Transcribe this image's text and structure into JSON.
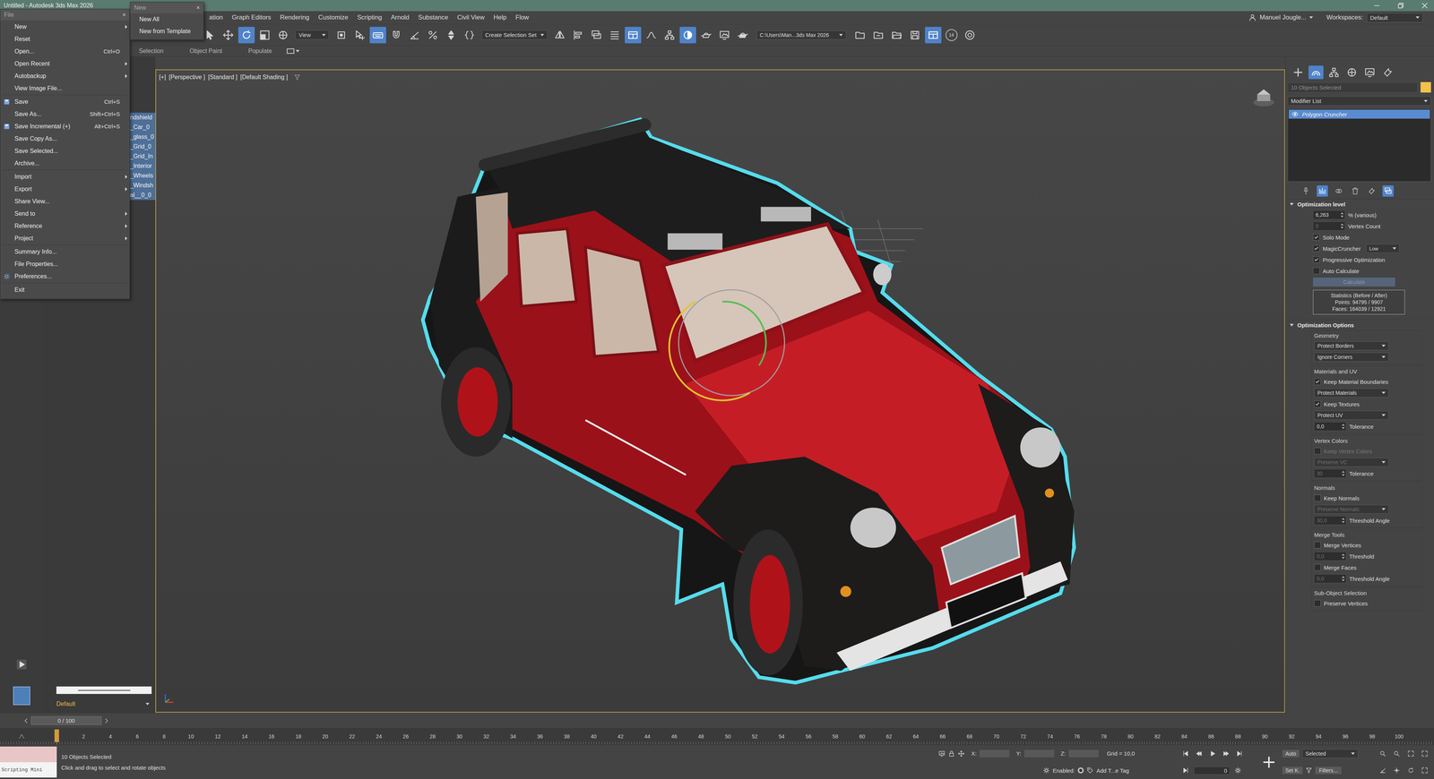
{
  "window": {
    "title": "Untitled - Autodesk 3ds Max 2026"
  },
  "menu_bar": {
    "items": [
      "ation",
      "Graph Editors",
      "Rendering",
      "Customize",
      "Scripting",
      "Arnold",
      "Substance",
      "Civil View",
      "Help",
      "Flow"
    ],
    "user": "Manuel Jougle...",
    "workspaces_label": "Workspaces:",
    "workspace": "Default"
  },
  "toolbar": {
    "items": [
      {
        "kind": "select",
        "selected": false
      },
      {
        "kind": "move",
        "selected": false
      },
      {
        "kind": "rotate",
        "selected": true
      },
      {
        "kind": "scale",
        "selected": false
      },
      {
        "kind": "place",
        "selected": false
      },
      {
        "kind": "dropdown",
        "label": "View",
        "selected": false
      },
      {
        "kind": "pivot",
        "selected": false
      },
      {
        "kind": "manip",
        "selected": false
      },
      {
        "kind": "keyboard",
        "selected": true
      },
      {
        "kind": "snap",
        "selected": false
      },
      {
        "kind": "angle-snap",
        "selected": false
      },
      {
        "kind": "percent-snap",
        "selected": false
      },
      {
        "kind": "spinner-snap",
        "selected": false
      },
      {
        "kind": "named-set",
        "selected": false
      },
      {
        "kind": "dropdown",
        "label": "Create Selection Set",
        "selected": false
      },
      {
        "kind": "mirror",
        "selected": false
      },
      {
        "kind": "align",
        "selected": false
      },
      {
        "kind": "layers",
        "selected": false
      },
      {
        "kind": "explorer",
        "selected": false
      },
      {
        "kind": "ribbon",
        "selected": true
      },
      {
        "kind": "curve",
        "selected": false
      },
      {
        "kind": "schematic",
        "selected": false
      },
      {
        "kind": "material",
        "selected": true
      },
      {
        "kind": "render-setup",
        "selected": false
      },
      {
        "kind": "rendered-frame",
        "selected": false
      },
      {
        "kind": "render",
        "selected": false
      },
      {
        "kind": "path",
        "label": "C:\\Users\\Man...3ds Max 2026",
        "selected": false
      },
      {
        "kind": "folder",
        "selected": false
      },
      {
        "kind": "project",
        "selected": false
      },
      {
        "kind": "folder-open",
        "selected": false
      },
      {
        "kind": "save",
        "selected": false
      },
      {
        "kind": "grid",
        "selected": true
      },
      {
        "kind": "badge",
        "label": "14",
        "selected": false
      },
      {
        "kind": "help",
        "selected": false
      }
    ]
  },
  "ribbon": {
    "tabs": [
      "Selection",
      "Object Paint",
      "Populate"
    ]
  },
  "scene_explorer": {
    "items": [
      {
        "name": "ndshield",
        "selected": true
      },
      {
        "name": "_Car_0",
        "selected": true
      },
      {
        "name": "_glass_0",
        "selected": true
      },
      {
        "name": "_Grid_0",
        "selected": true
      },
      {
        "name": "_Grid_In",
        "selected": true
      },
      {
        "name": "_Interior",
        "selected": true
      },
      {
        "name": "_Wheels",
        "selected": true
      },
      {
        "name": "_Windsh",
        "selected": true
      },
      {
        "name": "al__0_0",
        "selected": true
      }
    ],
    "layer": "Default"
  },
  "file_menu": {
    "title": "File",
    "close": "×",
    "groups": [
      [
        {
          "label": "New",
          "shortcut": "",
          "submenu": true,
          "kind": "plain"
        },
        {
          "label": "Reset",
          "shortcut": "",
          "submenu": false,
          "kind": "plain"
        },
        {
          "label": "Open...",
          "shortcut": "Ctrl+O",
          "submenu": false,
          "kind": "plain"
        },
        {
          "label": "Open Recent",
          "shortcut": "",
          "submenu": true,
          "kind": "plain"
        },
        {
          "label": "Autobackup",
          "shortcut": "",
          "submenu": true,
          "kind": "plain"
        },
        {
          "label": "View Image File...",
          "shortcut": "",
          "submenu": false,
          "kind": "plain"
        }
      ],
      [
        {
          "label": "Save",
          "shortcut": "Ctrl+S",
          "submenu": false,
          "kind": "icon"
        },
        {
          "label": "Save As...",
          "shortcut": "Shift+Ctrl+S",
          "submenu": false,
          "kind": "plain"
        },
        {
          "label": "Save Incremental (+)",
          "shortcut": "Alt+Ctrl+S",
          "submenu": false,
          "kind": "icon"
        },
        {
          "label": "Save Copy As...",
          "shortcut": "",
          "submenu": false,
          "kind": "plain"
        },
        {
          "label": "Save Selected...",
          "shortcut": "",
          "submenu": false,
          "kind": "plain"
        },
        {
          "label": "Archive...",
          "shortcut": "",
          "submenu": false,
          "kind": "plain"
        }
      ],
      [
        {
          "label": "Import",
          "shortcut": "",
          "submenu": true,
          "kind": "plain"
        },
        {
          "label": "Export",
          "shortcut": "",
          "submenu": true,
          "kind": "plain"
        },
        {
          "label": "Share View...",
          "shortcut": "",
          "submenu": false,
          "kind": "plain"
        },
        {
          "label": "Send to",
          "shortcut": "",
          "submenu": true,
          "kind": "plain"
        },
        {
          "label": "Reference",
          "shortcut": "",
          "submenu": true,
          "kind": "plain"
        },
        {
          "label": "Project",
          "shortcut": "",
          "submenu": true,
          "kind": "plain"
        }
      ],
      [
        {
          "label": "Summary Info...",
          "shortcut": "",
          "submenu": false,
          "kind": "plain"
        },
        {
          "label": "File Properties...",
          "shortcut": "",
          "submenu": false,
          "kind": "plain"
        },
        {
          "label": "Preferences...",
          "shortcut": "",
          "submenu": false,
          "kind": "gear"
        }
      ],
      [
        {
          "label": "Exit",
          "shortcut": "",
          "submenu": false,
          "kind": "plain"
        }
      ]
    ]
  },
  "new_submenu": {
    "title": "New",
    "close": "×",
    "items": [
      "New All",
      "New from Template"
    ]
  },
  "viewport": {
    "labels": [
      "[+]",
      "[Perspective ]",
      "[Standard ]",
      "[Default Shading ]"
    ],
    "active": true
  },
  "command_panel": {
    "tabs": [
      {
        "kind": "create",
        "selected": false
      },
      {
        "kind": "modify",
        "selected": true
      },
      {
        "kind": "hierarchy",
        "selected": false
      },
      {
        "kind": "motion",
        "selected": false
      },
      {
        "kind": "display",
        "selected": false
      },
      {
        "kind": "utilities",
        "selected": false
      }
    ],
    "object_name": "10 Objects Selected",
    "modifier_list": "Modifier List",
    "stack": [
      {
        "name": "Polygon Cruncher",
        "selected": true
      }
    ],
    "stack_tools": [
      {
        "kind": "pin",
        "selected": false
      },
      {
        "kind": "show-end",
        "selected": true
      },
      {
        "kind": "make-unique",
        "selected": false
      },
      {
        "kind": "remove",
        "selected": false
      },
      {
        "kind": "configure",
        "selected": false
      },
      {
        "kind": "stack-list",
        "selected": true
      }
    ],
    "rollouts": [
      {
        "title": "Optimization level",
        "expanded": true,
        "groups": [
          {
            "label": "",
            "rows": [
              {
                "kind": "spinner",
                "value": "6,263",
                "label": "% (various)",
                "disabled": false
              },
              {
                "kind": "spinner",
                "value": "0",
                "label": "Vertex Count",
                "disabled": true
              },
              {
                "kind": "check",
                "label": "Solo Mode",
                "checked": true,
                "disabled": false
              },
              {
                "kind": "check-dropdown",
                "label": "MagicCruncher",
                "checked": true,
                "value": "Low",
                "disabled": false
              },
              {
                "kind": "check",
                "label": "Progressive Optimization",
                "checked": true,
                "disabled": false
              },
              {
                "kind": "check",
                "label": "Auto Calculate",
                "checked": false,
                "disabled": false
              },
              {
                "kind": "button",
                "label": "Calculate",
                "disabled": true
              },
              {
                "kind": "stats",
                "lines": [
                  "Statistics (Before / After)",
                  "Points: 94795 / 9907",
                  "Faces: 164039 / 12921"
                ]
              }
            ]
          }
        ]
      },
      {
        "title": "Optimization Options",
        "expanded": true,
        "groups": [
          {
            "label": "Geometry",
            "rows": [
              {
                "kind": "dropdown",
                "value": "Protect Borders",
                "disabled": false
              },
              {
                "kind": "dropdown",
                "value": "Ignore Corners",
                "disabled": false
              }
            ]
          },
          {
            "label": "Materials and UV",
            "rows": [
              {
                "kind": "check",
                "label": "Keep Material Boundaries",
                "checked": true,
                "disabled": false
              },
              {
                "kind": "dropdown",
                "value": "Protect Materials",
                "disabled": false
              },
              {
                "kind": "check",
                "label": "Keep Textures",
                "checked": true,
                "disabled": false
              },
              {
                "kind": "dropdown",
                "value": "Protect UV",
                "disabled": false
              },
              {
                "kind": "spinner",
                "value": "0,0",
                "label": "Tolerance",
                "disabled": false
              }
            ]
          },
          {
            "label": "Vertex Colors",
            "rows": [
              {
                "kind": "check",
                "label": "Keep Vertex Colors",
                "checked": false,
                "disabled": true
              },
              {
                "kind": "dropdown",
                "value": "Preserve VC",
                "disabled": true
              },
              {
                "kind": "spinner",
                "value": "30",
                "label": "Tolerance",
                "disabled": true
              }
            ]
          },
          {
            "label": "Normals",
            "rows": [
              {
                "kind": "check",
                "label": "Keep Normals",
                "checked": false,
                "disabled": false
              },
              {
                "kind": "dropdown",
                "value": "Preserve Normals",
                "disabled": true
              },
              {
                "kind": "spinner",
                "value": "30,0",
                "label": "Threshold Angle",
                "disabled": true
              }
            ]
          },
          {
            "label": "Merge Tools",
            "rows": [
              {
                "kind": "check",
                "label": "Merge Vertices",
                "checked": false,
                "disabled": false
              },
              {
                "kind": "spinner",
                "value": "0,0",
                "label": "Threshold",
                "disabled": true
              },
              {
                "kind": "check",
                "label": "Merge Faces",
                "checked": false,
                "disabled": false
              },
              {
                "kind": "spinner",
                "value": "0,0",
                "label": "Threshold Angle",
                "disabled": true
              }
            ]
          },
          {
            "label": "Sub-Object Selection",
            "rows": [
              {
                "kind": "check",
                "label": "Preserve Vertices",
                "checked": false,
                "disabled": false
              }
            ]
          }
        ]
      }
    ]
  },
  "timeline": {
    "slider": "0 / 100",
    "level": 0,
    "ticks": [
      "2",
      "4",
      "6",
      "8",
      "10",
      "12",
      "14",
      "16",
      "18",
      "20",
      "22",
      "24",
      "26",
      "28",
      "30",
      "32",
      "34",
      "36",
      "38",
      "40",
      "42",
      "44",
      "46",
      "48",
      "50",
      "52",
      "54",
      "56",
      "58",
      "60",
      "62",
      "64",
      "66",
      "68",
      "70",
      "72",
      "74",
      "76",
      "78",
      "80",
      "82",
      "84",
      "86",
      "88",
      "90",
      "92",
      "94",
      "96",
      "98",
      "100"
    ]
  },
  "status_bar": {
    "listener": "Scripting Mini",
    "selection": "10 Objects Selected",
    "prompt": "Click and drag to select and rotate objects",
    "coords": [
      {
        "label": "X:",
        "value": ""
      },
      {
        "label": "Y:",
        "value": ""
      },
      {
        "label": "Z:",
        "value": ""
      }
    ],
    "grid": "Grid = 10,0",
    "isolation_label": "Enabled:",
    "isolation_on": true,
    "tag": "Add T...e Tag",
    "playback": [
      {
        "kind": "first"
      },
      {
        "kind": "prev"
      },
      {
        "kind": "play"
      },
      {
        "kind": "next"
      },
      {
        "kind": "last"
      }
    ],
    "frame": "0",
    "auto_key": {
      "label": "Auto",
      "on": false
    },
    "key_mode": "Selected",
    "set_key": "Set K.",
    "filters": "Filters...",
    "nav_tools": [
      {
        "kind": "zoom"
      },
      {
        "kind": "zoom-all"
      },
      {
        "kind": "zoom-extents"
      },
      {
        "kind": "zoom-extents-all"
      },
      {
        "kind": "fov"
      },
      {
        "kind": "pan"
      },
      {
        "kind": "orbit"
      },
      {
        "kind": "maximize"
      }
    ]
  }
}
